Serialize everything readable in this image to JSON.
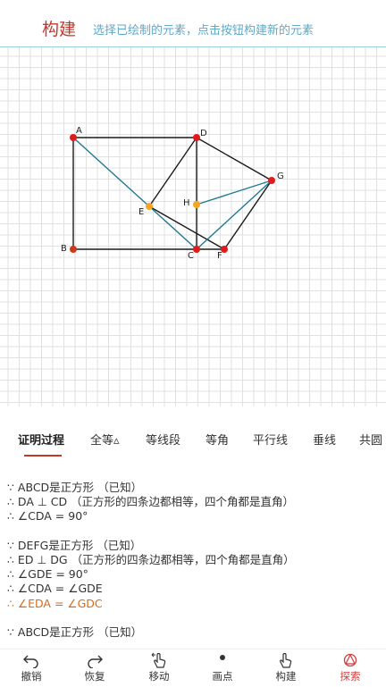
{
  "header": {
    "title": "构建",
    "hint": "选择已绘制的元素，点击按钮构建新的元素"
  },
  "points": [
    {
      "label": "A",
      "color": "#e01b1b"
    },
    {
      "label": "D",
      "color": "#e01b1b"
    },
    {
      "label": "G",
      "color": "#e01b1b"
    },
    {
      "label": "H",
      "color": "#f5a623"
    },
    {
      "label": "E",
      "color": "#f5a623"
    },
    {
      "label": "B",
      "color": "#cc3a1a"
    },
    {
      "label": "C",
      "color": "#e01b1b"
    },
    {
      "label": "F",
      "color": "#e01b1b"
    }
  ],
  "colors": {
    "segment": "#1a1a1a",
    "construction": "#1f7a93",
    "accent": "#c0392b",
    "hint": "#5fa9c9",
    "highlight": "#d96a1a"
  },
  "tabs": [
    "证明过程",
    "全等▵",
    "等线段",
    "等角",
    "平行线",
    "垂线",
    "共圆"
  ],
  "proof": [
    {
      "text": "∵ ABCD是正方形 （已知）"
    },
    {
      "text": "∴ DA ⊥ CD （正方形的四条边都相等，四个角都是直角）"
    },
    {
      "text": "∴ ∠CDA = 90°"
    },
    {
      "text": ""
    },
    {
      "text": "∵ DEFG是正方形 （已知）"
    },
    {
      "text": "∴ ED ⊥ DG （正方形的四条边都相等，四个角都是直角）"
    },
    {
      "text": "∴ ∠GDE = 90°"
    },
    {
      "text": "∴ ∠CDA = ∠GDE"
    },
    {
      "text": "∴ ∠EDA = ∠GDC",
      "highlight": true
    },
    {
      "text": ""
    },
    {
      "text": "∵ ABCD是正方形 （已知）"
    }
  ],
  "bottom_bar": [
    {
      "label": "撤销",
      "icon": "undo-icon"
    },
    {
      "label": "恢复",
      "icon": "redo-icon"
    },
    {
      "label": "移动",
      "icon": "hand-move-icon"
    },
    {
      "label": "画点",
      "icon": "dot-icon"
    },
    {
      "label": "构建",
      "icon": "hand-pointer-icon"
    },
    {
      "label": "探索",
      "icon": "explore-icon",
      "active": true
    }
  ]
}
